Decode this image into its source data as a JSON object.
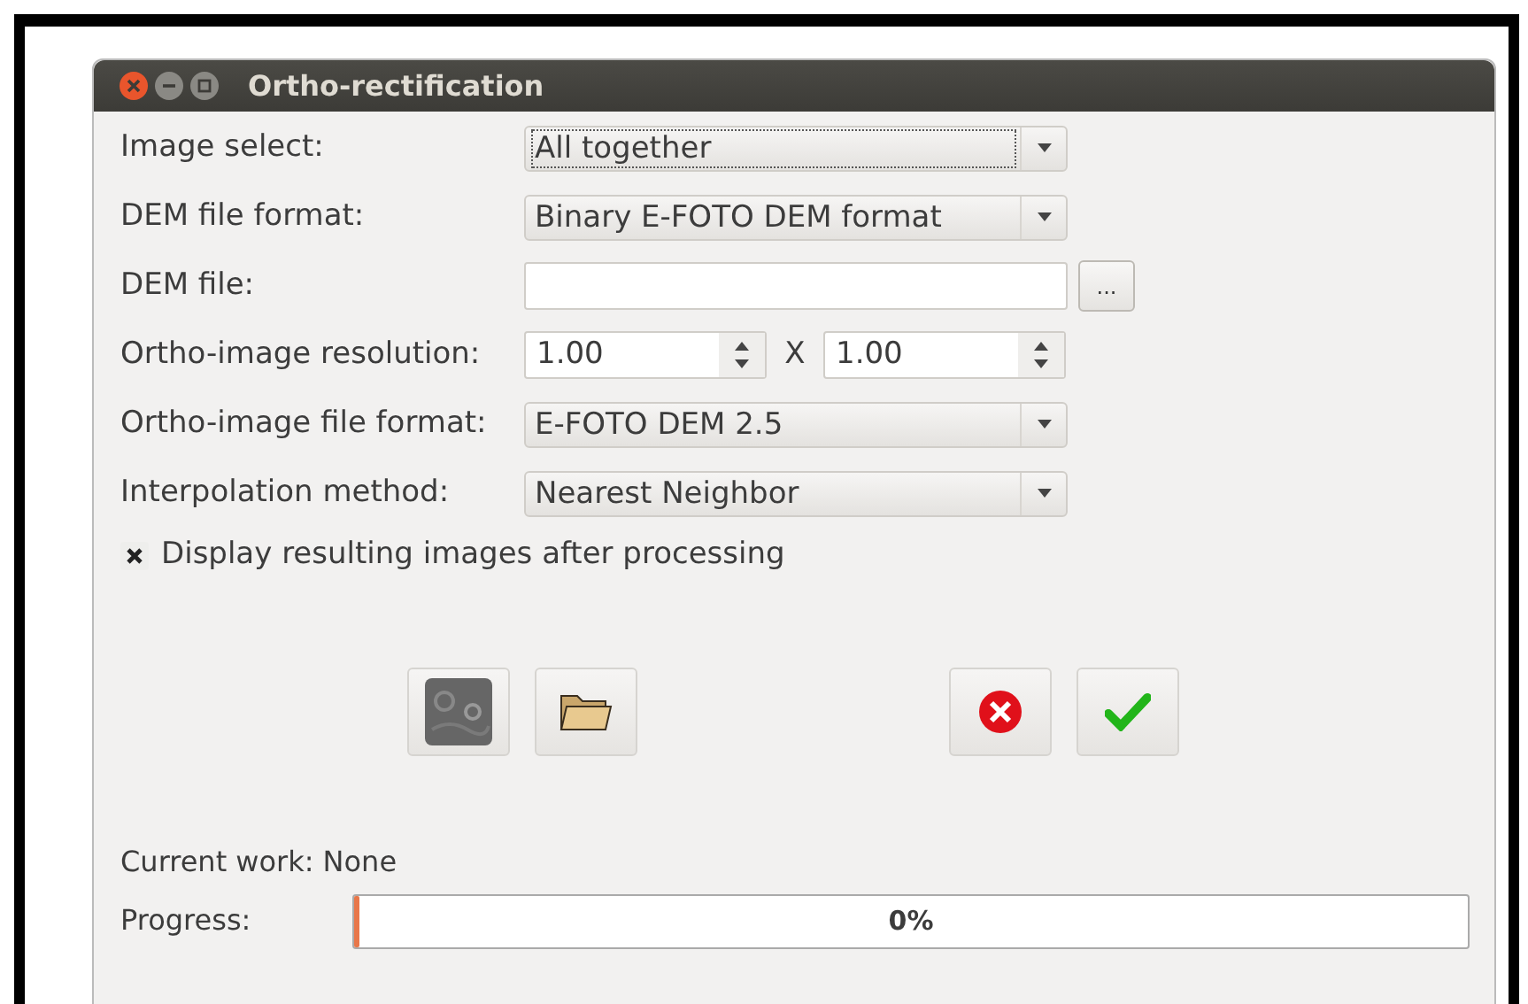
{
  "window": {
    "title": "Ortho-rectification"
  },
  "fields": [
    {
      "kind": "combo",
      "label": "Image select:",
      "value": "All together",
      "focused": true
    },
    {
      "kind": "combo",
      "label": "DEM file format:",
      "value": "Binary E-FOTO DEM format",
      "focused": false
    },
    {
      "kind": "file",
      "label": "DEM file:",
      "button": "..."
    },
    {
      "kind": "spin",
      "label": "Ortho-image resolution:",
      "value": "1.00",
      "separator": "X",
      "value2": "1.00"
    },
    {
      "kind": "combo",
      "label": "Ortho-image file format:",
      "value": "E-FOTO DEM 2.5",
      "focused": false
    },
    {
      "kind": "combo",
      "label": "Interpolation method:",
      "value": "Nearest Neighbor",
      "focused": false
    }
  ],
  "display_checkbox": {
    "label": "Display resulting images after processing",
    "checked": true
  },
  "current_work": {
    "label": "Current work:",
    "value": "None"
  },
  "progress": {
    "label": "Progress:",
    "level": 0.005,
    "text": "0%"
  }
}
